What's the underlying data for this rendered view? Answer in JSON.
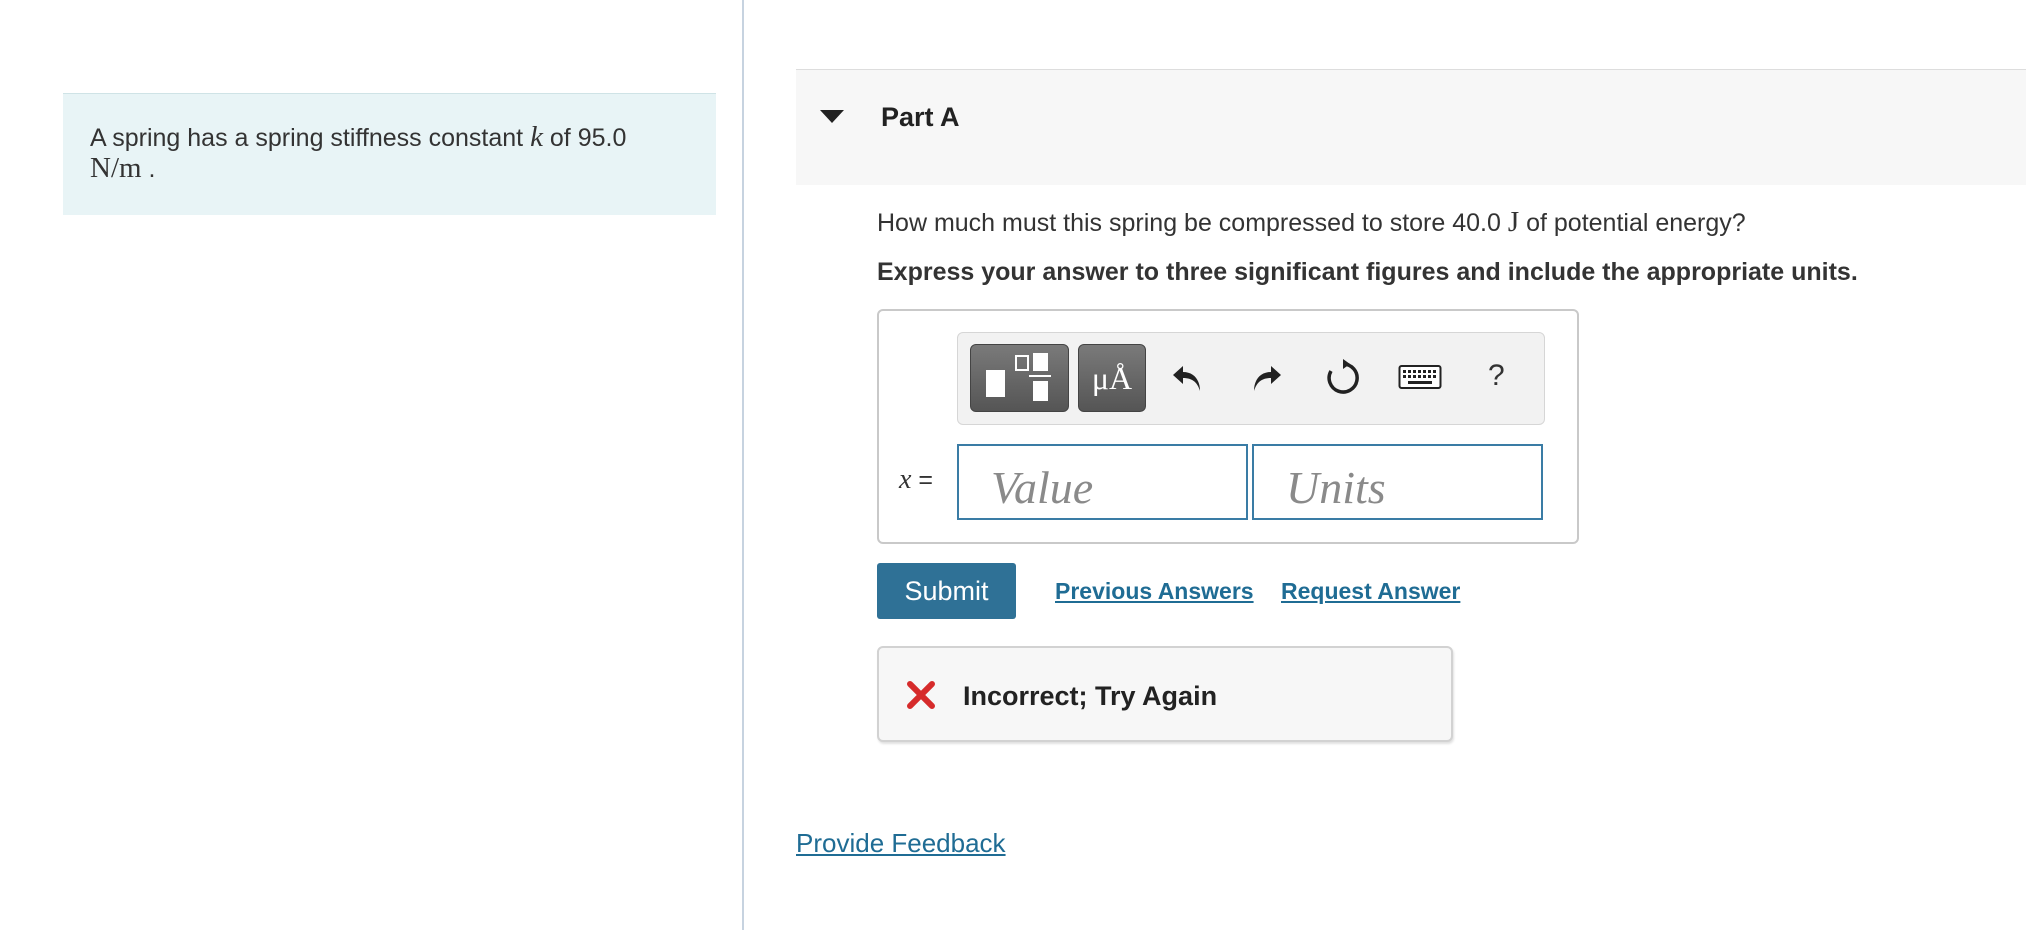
{
  "intro": {
    "text_before": "A spring has a spring stiffness constant ",
    "var": "k",
    "text_after": " of 95.0",
    "unit": "N/m",
    "period": " ."
  },
  "part": {
    "title": "Part A"
  },
  "question": {
    "text_before": "How much must this spring be compressed to store 40.0 ",
    "unit": "J",
    "text_after": " of potential energy?",
    "instruction": "Express your answer to three significant figures and include the appropriate units."
  },
  "answer": {
    "variable": "x",
    "equals": " =",
    "value_placeholder": "Value",
    "units_placeholder": "Units"
  },
  "toolbar": {
    "units_label": "μÅ",
    "help_label": "?",
    "icons": [
      "templates-icon",
      "units-icon",
      "undo-icon",
      "redo-icon",
      "reset-icon",
      "keyboard-icon",
      "help-icon"
    ]
  },
  "actions": {
    "submit_label": "Submit",
    "previous_answers": "Previous Answers",
    "request_answer": "Request Answer"
  },
  "feedback": {
    "message": "Incorrect; Try Again",
    "status_color": "#d62b2b"
  },
  "footer": {
    "provide_feedback": "Provide Feedback"
  },
  "colors": {
    "accent": "#2f7196",
    "link": "#1f6c94",
    "intro_bg": "#e8f4f6",
    "field_border": "#3a7ca5"
  }
}
